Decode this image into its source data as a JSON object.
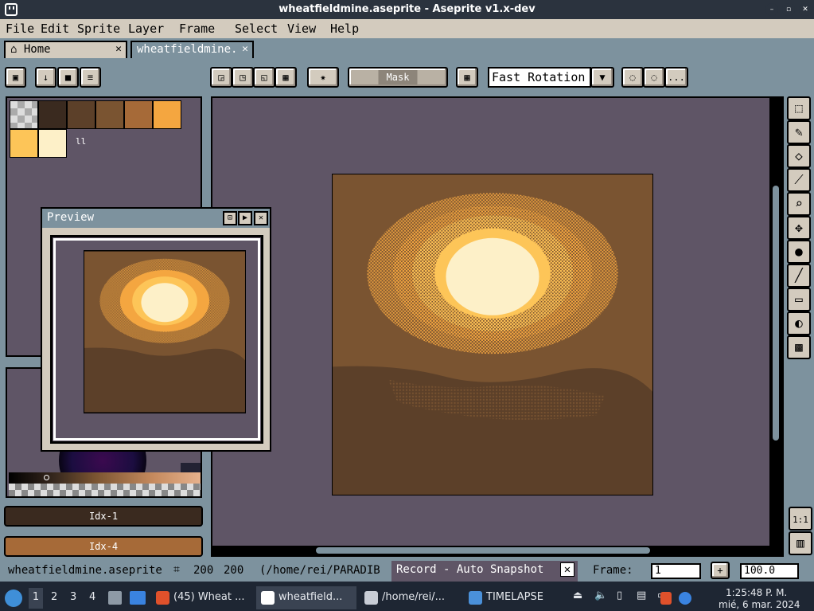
{
  "window": {
    "title": "wheatfieldmine.aseprite - Aseprite v1.x-dev"
  },
  "menu": [
    "File",
    "Edit",
    "Sprite",
    "Layer",
    "Frame",
    "Select",
    "View",
    "Help"
  ],
  "tabs": {
    "home": "Home",
    "file": "wheatfieldmine."
  },
  "toolbar": {
    "mask_label": "Mask",
    "rotation_algorithm": "Fast Rotation",
    "more_label": "..."
  },
  "palette": {
    "colors": [
      "#3a2a1f",
      "#5c4029",
      "#7a5431",
      "#a66a38",
      "#f4a640",
      "#fdc558",
      "#fdf0c8"
    ],
    "count_label": "ll"
  },
  "color_bars": {
    "fg": "Idx-1",
    "bg": "Idx-4",
    "fg_color": "#3a2a1f",
    "bg_color": "#a66a38"
  },
  "preview": {
    "title": "Preview"
  },
  "canvas": {
    "bg": "#5f5566"
  },
  "status": {
    "filename": "wheatfieldmine.aseprite",
    "size_w": "200",
    "size_h": "200",
    "path": "(/home/rei/PARADIB",
    "record": "Record - Auto Snapshot",
    "frame_label": "Frame:",
    "frame_value": "1",
    "zoom": "100.0"
  },
  "taskbar": {
    "workspaces": [
      "1",
      "2",
      "3",
      "4"
    ],
    "apps": [
      "(45) Wheat ...",
      "wheatfield...",
      "/home/rei/...",
      "TIMELAPSE"
    ],
    "time": "1:25:48 P. M.",
    "date": "mié, 6 mar. 2024"
  }
}
